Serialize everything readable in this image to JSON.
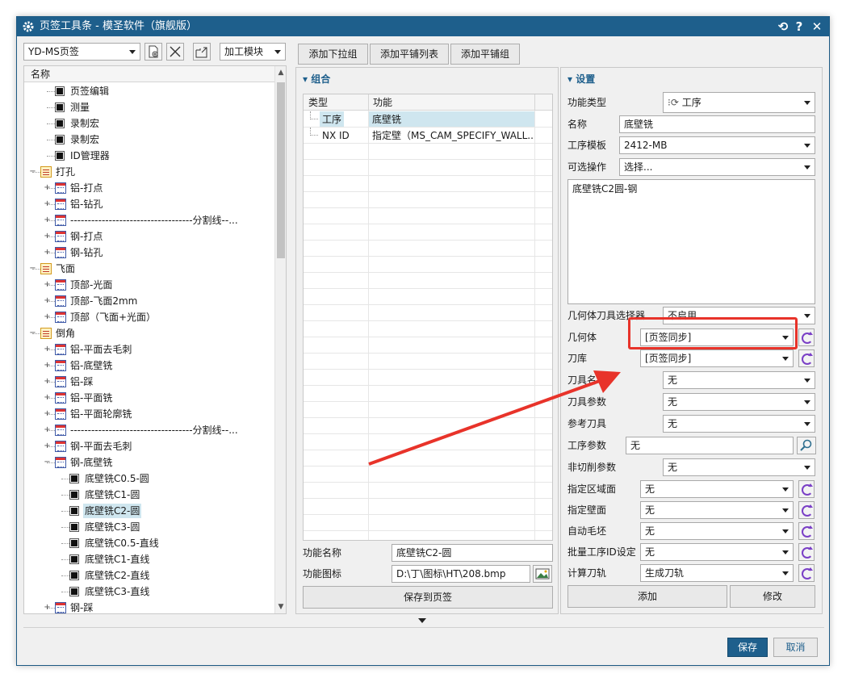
{
  "window": {
    "title": "页签工具条 - 模圣软件（旗舰版）",
    "controls": {
      "refresh": "⟲",
      "help": "?",
      "close": "✕"
    }
  },
  "toolbar": {
    "page_select": "YD-MS页签",
    "module_select": "加工模块",
    "add_dropdown_group": "添加下拉组",
    "add_tile_list": "添加平铺列表",
    "add_tile_group": "添加平铺组"
  },
  "tree": {
    "header": "名称",
    "rows": [
      {
        "level": 1,
        "icon": "black",
        "exp": "",
        "label": "页签编辑"
      },
      {
        "level": 1,
        "icon": "black",
        "exp": "",
        "label": "测量"
      },
      {
        "level": 1,
        "icon": "black",
        "exp": "",
        "label": "录制宏"
      },
      {
        "level": 1,
        "icon": "black",
        "exp": "",
        "label": "录制宏"
      },
      {
        "level": 1,
        "icon": "black",
        "exp": "",
        "label": "ID管理器"
      },
      {
        "level": 0,
        "icon": "folder",
        "exp": "−",
        "label": "打孔"
      },
      {
        "level": 1,
        "icon": "cal",
        "exp": "+",
        "label": "铝-打点"
      },
      {
        "level": 1,
        "icon": "cal",
        "exp": "+",
        "label": "铝-钻孔"
      },
      {
        "level": 1,
        "icon": "cal",
        "exp": "+",
        "label": "-----------------------------------分割线--..."
      },
      {
        "level": 1,
        "icon": "cal",
        "exp": "+",
        "label": "钢-打点"
      },
      {
        "level": 1,
        "icon": "cal",
        "exp": "+",
        "label": "钢-钻孔"
      },
      {
        "level": 0,
        "icon": "folder",
        "exp": "−",
        "label": "飞面"
      },
      {
        "level": 1,
        "icon": "cal",
        "exp": "+",
        "label": "顶部-光面"
      },
      {
        "level": 1,
        "icon": "cal",
        "exp": "+",
        "label": "顶部-飞面2mm"
      },
      {
        "level": 1,
        "icon": "cal",
        "exp": "+",
        "label": "顶部（飞面+光面）"
      },
      {
        "level": 0,
        "icon": "folder",
        "exp": "−",
        "label": "倒角"
      },
      {
        "level": 1,
        "icon": "cal",
        "exp": "+",
        "label": "铝-平面去毛刺"
      },
      {
        "level": 1,
        "icon": "cal",
        "exp": "+",
        "label": "铝-底壁铣"
      },
      {
        "level": 1,
        "icon": "cal",
        "exp": "+",
        "label": "铝-踩"
      },
      {
        "level": 1,
        "icon": "cal",
        "exp": "+",
        "label": "铝-平面铣"
      },
      {
        "level": 1,
        "icon": "cal",
        "exp": "+",
        "label": "铝-平面轮廓铣"
      },
      {
        "level": 1,
        "icon": "cal",
        "exp": "+",
        "label": "-----------------------------------分割线--..."
      },
      {
        "level": 1,
        "icon": "cal",
        "exp": "+",
        "label": "钢-平面去毛刺"
      },
      {
        "level": 1,
        "icon": "cal",
        "exp": "−",
        "label": "钢-底壁铣"
      },
      {
        "level": 2,
        "icon": "black",
        "exp": "",
        "label": "底壁铣C0.5-圆"
      },
      {
        "level": 2,
        "icon": "black",
        "exp": "",
        "label": "底壁铣C1-圆"
      },
      {
        "level": 2,
        "icon": "black",
        "exp": "",
        "label": "底壁铣C2-圆",
        "selected": true
      },
      {
        "level": 2,
        "icon": "black",
        "exp": "",
        "label": "底壁铣C3-圆"
      },
      {
        "level": 2,
        "icon": "black",
        "exp": "",
        "label": "底壁铣C0.5-直线"
      },
      {
        "level": 2,
        "icon": "black",
        "exp": "",
        "label": "底壁铣C1-直线"
      },
      {
        "level": 2,
        "icon": "black",
        "exp": "",
        "label": "底壁铣C2-直线"
      },
      {
        "level": 2,
        "icon": "black",
        "exp": "",
        "label": "底壁铣C3-直线"
      },
      {
        "level": 1,
        "icon": "cal",
        "exp": "+",
        "label": "钢-踩"
      }
    ]
  },
  "combo": {
    "title": "组合",
    "col_type": "类型",
    "col_func": "功能",
    "rows": [
      {
        "type": "工序",
        "func": "底壁铣"
      },
      {
        "type": "NX ID",
        "func": "指定壁（MS_CAM_SPECIFY_WALL..."
      }
    ],
    "func_name_label": "功能名称",
    "func_name_value": "底壁铣C2-圆",
    "func_icon_label": "功能图标",
    "func_icon_value": "D:\\丁\\图标\\HT\\208.bmp",
    "save_to_page": "保存到页签"
  },
  "settings": {
    "title": "设置",
    "func_type_label": "功能类型",
    "func_type_value": "工序",
    "name_label": "名称",
    "name_value": "底壁铣",
    "template_label": "工序模板",
    "template_value": "2412-MB",
    "optional_op_label": "可选操作",
    "optional_op_value": "选择...",
    "description": "底壁铣C2圆-钢",
    "geom_tool_sel_label": "几何体刀具选择器",
    "geom_tool_sel_value": "不启用",
    "geometry_label": "几何体",
    "geometry_value": "[页签同步]",
    "tool_lib_label": "刀库",
    "tool_lib_value": "[页签同步]",
    "tool_name_label": "刀具名",
    "tool_name_value": "无",
    "tool_param_label": "刀具参数",
    "tool_param_value": "无",
    "ref_tool_label": "参考刀具",
    "ref_tool_value": "无",
    "op_param_label": "工序参数",
    "op_param_value": "无",
    "noncut_label": "非切削参数",
    "noncut_value": "无",
    "area_label": "指定区域面",
    "area_value": "无",
    "wall_label": "指定壁面",
    "wall_value": "无",
    "blank_label": "自动毛坯",
    "blank_value": "无",
    "batch_id_label": "批量工序ID设定",
    "batch_id_value": "无",
    "calc_label": "计算刀轨",
    "calc_value": "生成刀轨",
    "add_button": "添加",
    "modify_button": "修改"
  },
  "footer": {
    "save": "保存",
    "cancel": "取消"
  },
  "colors": {
    "titlebar": "#1e5f8c",
    "accent": "#1e5f8c",
    "highlight": "#e8332a",
    "selection": "#cfe6ef"
  }
}
